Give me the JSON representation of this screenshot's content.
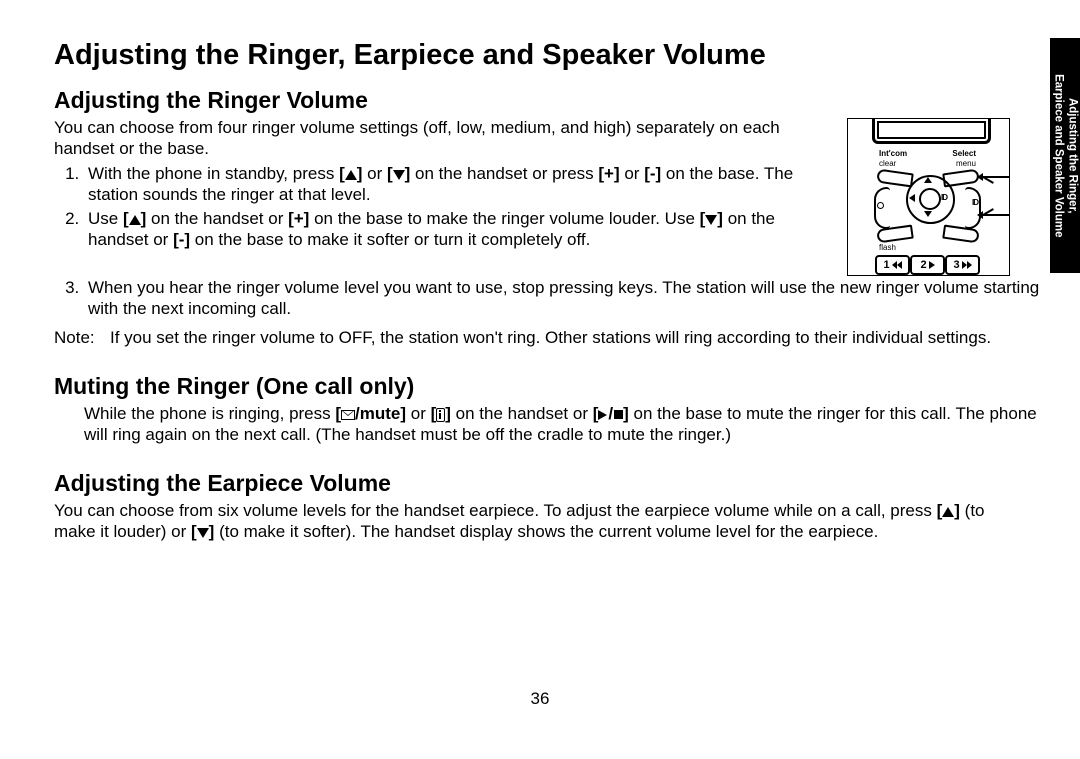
{
  "side_tab": {
    "line1": "Adjusting the Ringer,",
    "line2": "Earpiece and Speaker Volume"
  },
  "title": "Adjusting the Ringer, Earpiece and Speaker Volume",
  "sec1": {
    "heading": "Adjusting the Ringer Volume",
    "intro": "You can choose from four ringer volume settings (off, low, medium, and high) separately on each handset or the base.",
    "steps": {
      "s1a": "With the phone in standby, press ",
      "s1b": " or ",
      "s1c": " on the handset or press ",
      "s1d": "[+]",
      "s1e": " or ",
      "s1f": "[-]",
      "s1g": " on the base. The station sounds the ringer at that level.",
      "s2a": "Use ",
      "s2b": " on the handset or ",
      "s2c": "[+]",
      "s2d": " on the base to make the ringer volume louder. Use ",
      "s2e": " on the handset or ",
      "s2f": "[-]",
      "s2g": " on the base to make it softer or turn it completely off.",
      "s3": "When you hear the ringer volume level you want to use, stop pressing keys. The station will use the new ringer volume starting with the next incoming call."
    },
    "note_label": "Note:",
    "note_text": "If you set the ringer volume to OFF, the station won't ring. Other stations will ring according to their individual settings."
  },
  "sec2": {
    "heading": "Muting the Ringer (One call only)",
    "p_a": "While the phone is ringing, press ",
    "p_mute": "/mute]",
    "p_b": " or ",
    "p_c": " on the handset or ",
    "p_d": " on the base to mute the ringer for this call. The phone will ring again on the next call. (The handset must be off the cradle to mute the ringer.)"
  },
  "sec3": {
    "heading": "Adjusting the Earpiece Volume",
    "p_a": "You can choose from six volume levels for the handset earpiece. To adjust the earpiece volume while on a call, press ",
    "p_b": " (to make it louder) or ",
    "p_c": " (to make it softer). The handset display shows the current volume level for the earpiece."
  },
  "illus": {
    "intcom": "Int'com",
    "select": "Select",
    "clear": "clear",
    "menu": "menu",
    "flash": "flash",
    "id": "ID",
    "k1": "1",
    "k2": "2",
    "k3": "3"
  },
  "page_number": "36"
}
